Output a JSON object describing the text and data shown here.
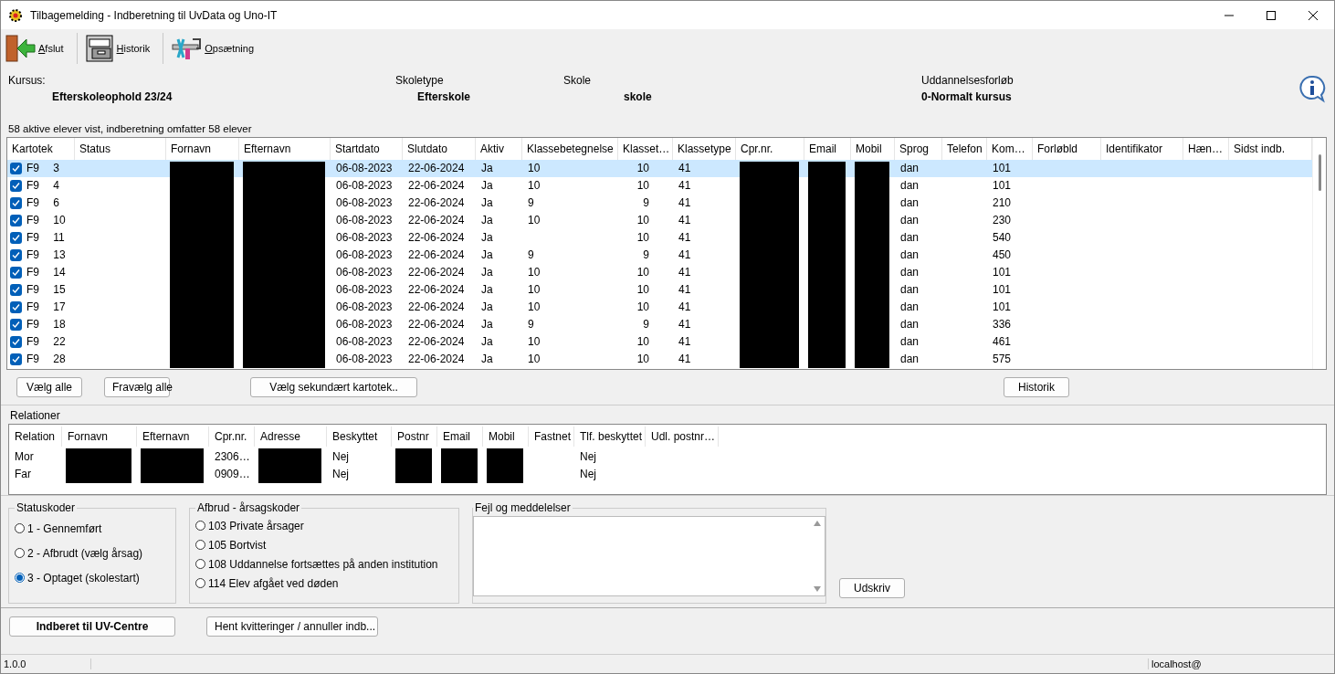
{
  "window": {
    "title": "Tilbagemelding - Indberetning til UvData og Uno-IT"
  },
  "toolbar": [
    {
      "label": "Afslut",
      "kind": "exit"
    },
    {
      "label": "Historik",
      "kind": "history"
    },
    {
      "label": "Opsætning",
      "kind": "setup"
    }
  ],
  "course": {
    "kursus_label": "Kursus:",
    "kursus": "Efterskoleophold 23/24",
    "skoletype_label": "Skoletype",
    "skoletype": "Efterskole",
    "skole_label": "Skole",
    "skole": "skole",
    "forloeb_label": "Uddannelsesforløb",
    "forloeb": "0-Normalt kursus"
  },
  "students_summary": "58 aktive elever vist, indberetning omfatter 58 elever",
  "students": {
    "columns": [
      {
        "label": "Kartotek",
        "redacted": false
      },
      {
        "label": "Status",
        "redacted": false
      },
      {
        "label": "Fornavn",
        "redacted": true
      },
      {
        "label": "Efternavn",
        "redacted": true
      },
      {
        "label": "Startdato",
        "redacted": false
      },
      {
        "label": "Slutdato",
        "redacted": false
      },
      {
        "label": "Aktiv",
        "redacted": false
      },
      {
        "label": "Klassebetegnelse",
        "redacted": false
      },
      {
        "label": "Klasset…",
        "redacted": false
      },
      {
        "label": "Klassetype",
        "redacted": false
      },
      {
        "label": "Cpr.nr.",
        "redacted": true
      },
      {
        "label": "Email",
        "redacted": true
      },
      {
        "label": "Mobil",
        "redacted": true
      },
      {
        "label": "Sprog",
        "redacted": false
      },
      {
        "label": "Telefon",
        "redacted": false
      },
      {
        "label": "Kom…",
        "redacted": false
      },
      {
        "label": "Forløbld",
        "redacted": false
      },
      {
        "label": "Identifikator",
        "redacted": false
      },
      {
        "label": "Hæn…",
        "redacted": false
      },
      {
        "label": "Sidst indb.",
        "redacted": false
      }
    ],
    "rows": [
      {
        "checked": true,
        "selected": true,
        "cells": [
          "F9 3",
          "",
          "",
          "",
          "06-08-2023",
          "22-06-2024",
          "Ja",
          "10",
          "10",
          "41",
          "",
          "",
          "",
          "dan",
          "",
          "101",
          "",
          "",
          "",
          ""
        ]
      },
      {
        "checked": true,
        "selected": false,
        "cells": [
          "F9 4",
          "",
          "",
          "",
          "06-08-2023",
          "22-06-2024",
          "Ja",
          "10",
          "10",
          "41",
          "",
          "",
          "",
          "dan",
          "",
          "101",
          "",
          "",
          "",
          ""
        ]
      },
      {
        "checked": true,
        "selected": false,
        "cells": [
          "F9 6",
          "",
          "",
          "",
          "06-08-2023",
          "22-06-2024",
          "Ja",
          "9",
          "9",
          "41",
          "",
          "",
          "",
          "dan",
          "",
          "210",
          "",
          "",
          "",
          ""
        ]
      },
      {
        "checked": true,
        "selected": false,
        "cells": [
          "F9 10",
          "",
          "",
          "",
          "06-08-2023",
          "22-06-2024",
          "Ja",
          "10",
          "10",
          "41",
          "",
          "",
          "",
          "dan",
          "",
          "230",
          "",
          "",
          "",
          ""
        ]
      },
      {
        "checked": true,
        "selected": false,
        "cells": [
          "F9 11",
          "",
          "",
          "",
          "06-08-2023",
          "22-06-2024",
          "Ja",
          "",
          "10",
          "41",
          "",
          "",
          "",
          "dan",
          "",
          "540",
          "",
          "",
          "",
          ""
        ]
      },
      {
        "checked": true,
        "selected": false,
        "cells": [
          "F9 13",
          "",
          "",
          "",
          "06-08-2023",
          "22-06-2024",
          "Ja",
          "9",
          "9",
          "41",
          "",
          "",
          "",
          "dan",
          "",
          "450",
          "",
          "",
          "",
          ""
        ]
      },
      {
        "checked": true,
        "selected": false,
        "cells": [
          "F9 14",
          "",
          "",
          "",
          "06-08-2023",
          "22-06-2024",
          "Ja",
          "10",
          "10",
          "41",
          "",
          "",
          "",
          "dan",
          "",
          "101",
          "",
          "",
          "",
          ""
        ]
      },
      {
        "checked": true,
        "selected": false,
        "cells": [
          "F9 15",
          "",
          "",
          "",
          "06-08-2023",
          "22-06-2024",
          "Ja",
          "10",
          "10",
          "41",
          "",
          "",
          "",
          "dan",
          "",
          "101",
          "",
          "",
          "",
          ""
        ]
      },
      {
        "checked": true,
        "selected": false,
        "cells": [
          "F9 17",
          "",
          "",
          "",
          "06-08-2023",
          "22-06-2024",
          "Ja",
          "10",
          "10",
          "41",
          "",
          "",
          "",
          "dan",
          "",
          "101",
          "",
          "",
          "",
          ""
        ]
      },
      {
        "checked": true,
        "selected": false,
        "cells": [
          "F9 18",
          "",
          "",
          "",
          "06-08-2023",
          "22-06-2024",
          "Ja",
          "9",
          "9",
          "41",
          "",
          "",
          "",
          "dan",
          "",
          "336",
          "",
          "",
          "",
          ""
        ]
      },
      {
        "checked": true,
        "selected": false,
        "cells": [
          "F9 22",
          "",
          "",
          "",
          "06-08-2023",
          "22-06-2024",
          "Ja",
          "10",
          "10",
          "41",
          "",
          "",
          "",
          "dan",
          "",
          "461",
          "",
          "",
          "",
          ""
        ]
      },
      {
        "checked": true,
        "selected": false,
        "cells": [
          "F9 28",
          "",
          "",
          "",
          "06-08-2023",
          "22-06-2024",
          "Ja",
          "10",
          "10",
          "41",
          "",
          "",
          "",
          "dan",
          "",
          "575",
          "",
          "",
          "",
          ""
        ]
      }
    ]
  },
  "list_buttons": [
    "Vælg alle",
    "Fravælg alle",
    "Vælg sekundært kartotek..",
    "Historik"
  ],
  "relations": {
    "title": "Relationer",
    "columns": [
      {
        "label": "Relation",
        "redacted": false
      },
      {
        "label": "Fornavn",
        "redacted": true
      },
      {
        "label": "Efternavn",
        "redacted": true
      },
      {
        "label": "Cpr.nr.",
        "redacted": false
      },
      {
        "label": "Adresse",
        "redacted": true
      },
      {
        "label": "Beskyttet",
        "redacted": false
      },
      {
        "label": "Postnr",
        "redacted": true
      },
      {
        "label": "Email",
        "redacted": true
      },
      {
        "label": "Mobil",
        "redacted": true
      },
      {
        "label": "Fastnet",
        "redacted": false
      },
      {
        "label": "Tlf. beskyttet",
        "redacted": false
      },
      {
        "label": "Udl. postnr…",
        "redacted": false
      }
    ],
    "rows": [
      {
        "cells": [
          "Mor",
          "",
          "",
          "2306…",
          "",
          "Nej",
          "",
          "",
          "",
          "",
          "Nej",
          ""
        ]
      },
      {
        "cells": [
          "Far",
          "",
          "",
          "0909…",
          "",
          "Nej",
          "",
          "",
          "",
          "",
          "Nej",
          ""
        ]
      }
    ]
  },
  "status_codes": {
    "title": "Statuskoder",
    "options": [
      {
        "label": "1 - Gennemført",
        "selected": false
      },
      {
        "label": "2 - Afbrudt (vælg årsag)",
        "selected": false
      },
      {
        "label": "3 - Optaget (skolestart)",
        "selected": true
      }
    ]
  },
  "dropout_codes": {
    "title": "Afbrud - årsagskoder",
    "options": [
      {
        "label": "103 Private årsager",
        "selected": false
      },
      {
        "label": "105 Bortvist",
        "selected": false
      },
      {
        "label": "108 Uddannelse fortsættes på anden institution",
        "selected": false
      },
      {
        "label": "114 Elev afgået ved døden",
        "selected": false
      }
    ]
  },
  "messages": {
    "title": "Fejl og meddelelser"
  },
  "print_button": "Udskriv",
  "action_buttons": [
    {
      "label": "Indberet til UV-Centre",
      "kind": "primary"
    },
    {
      "label": "Hent kvitteringer / annuller indb...",
      "kind": "normal"
    }
  ],
  "status_bar": {
    "version": "1.0.0",
    "connection": "localhost@"
  }
}
